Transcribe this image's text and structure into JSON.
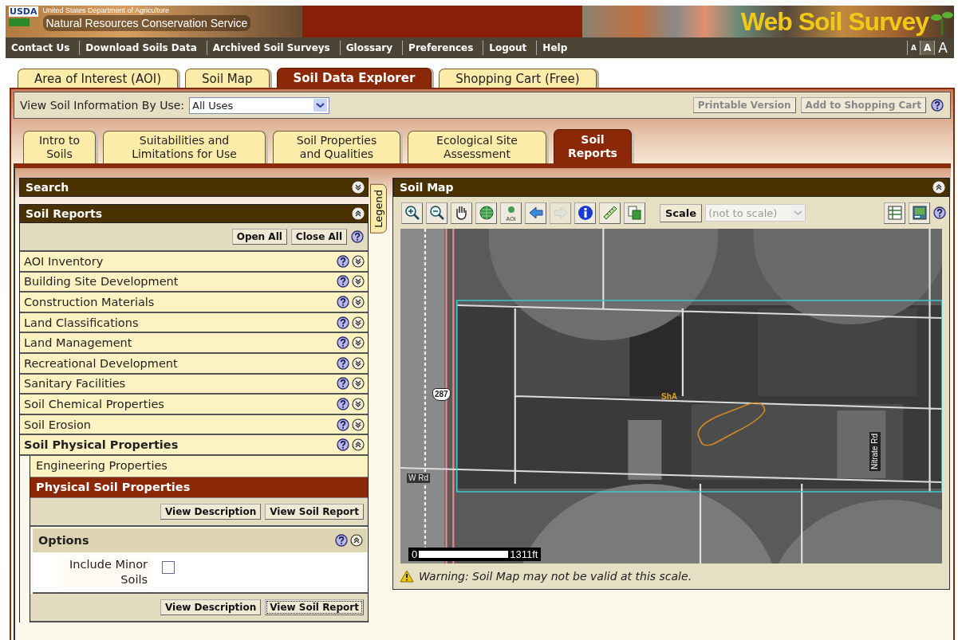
{
  "header": {
    "agency_small": "United States Department of Agriculture",
    "agency": "Natural Resources Conservation Service",
    "logo": "USDA",
    "app_title": "Web Soil Survey"
  },
  "nav": {
    "links": [
      "Contact Us",
      "Download Soils Data",
      "Archived Soil Surveys",
      "Glossary",
      "Preferences",
      "Logout",
      "Help"
    ],
    "text_sizes": [
      {
        "label": "A",
        "selected": false
      },
      {
        "label": "A",
        "selected": true
      },
      {
        "label": "A",
        "selected": false
      }
    ]
  },
  "main_tabs": [
    {
      "label": "Area of Interest (AOI)",
      "selected": false
    },
    {
      "label": "Soil Map",
      "selected": false
    },
    {
      "label": "Soil Data Explorer",
      "selected": true
    },
    {
      "label": "Shopping Cart (Free)",
      "selected": false
    }
  ],
  "toolbar": {
    "label": "View Soil Information By Use:",
    "select_value": "All Uses",
    "buttons": [
      {
        "label": "Printable Version",
        "disabled": true
      },
      {
        "label": "Add to Shopping Cart",
        "disabled": true
      }
    ]
  },
  "sub_tabs": [
    {
      "label": "Intro to Soils",
      "selected": false
    },
    {
      "label": "Suitabilities and Limitations for Use",
      "selected": false
    },
    {
      "label": "Soil Properties and Qualities",
      "selected": false
    },
    {
      "label": "Ecological Site Assessment",
      "selected": false
    },
    {
      "label": "Soil Reports",
      "selected": true
    }
  ],
  "search_panel": {
    "title": "Search",
    "expanded": false
  },
  "soil_reports": {
    "title": "Soil Reports",
    "expanded": true,
    "buttons": [
      "Open All",
      "Close All"
    ],
    "categories": [
      {
        "label": "AOI Inventory",
        "expanded": false
      },
      {
        "label": "Building Site Development",
        "expanded": false
      },
      {
        "label": "Construction Materials",
        "expanded": false
      },
      {
        "label": "Land Classifications",
        "expanded": false
      },
      {
        "label": "Land Management",
        "expanded": false
      },
      {
        "label": "Recreational Development",
        "expanded": false
      },
      {
        "label": "Sanitary Facilities",
        "expanded": false
      },
      {
        "label": "Soil Chemical Properties",
        "expanded": false
      },
      {
        "label": "Soil Erosion",
        "expanded": false
      },
      {
        "label": "Soil Physical Properties",
        "expanded": true,
        "children": [
          {
            "label": "Engineering Properties",
            "selected": false
          },
          {
            "label": "Physical Soil Properties",
            "selected": true,
            "buttons": [
              "View Description",
              "View Soil Report"
            ],
            "options": {
              "title": "Options",
              "expanded": true,
              "checkbox": {
                "label": "Include Minor Soils",
                "checked": false
              }
            },
            "bottom_buttons": [
              {
                "label": "View Description",
                "focused": false
              },
              {
                "label": "View Soil Report",
                "focused": true
              }
            ]
          }
        ]
      }
    ]
  },
  "legend_tab": "Legend",
  "map_panel": {
    "title": "Soil Map",
    "expanded": true,
    "tools": [
      {
        "kind": "zoom-in",
        "disabled": false
      },
      {
        "kind": "zoom-out",
        "disabled": false
      },
      {
        "kind": "pan",
        "disabled": false
      },
      {
        "kind": "globe",
        "disabled": false
      },
      {
        "kind": "aoi",
        "label": "AOI",
        "disabled": false
      },
      {
        "kind": "back",
        "disabled": false
      },
      {
        "kind": "forward",
        "disabled": true
      },
      {
        "kind": "info",
        "disabled": false
      },
      {
        "kind": "measure",
        "disabled": false
      },
      {
        "kind": "copy",
        "disabled": false
      }
    ],
    "scale_button": "Scale",
    "scale_select": {
      "value": "(not to scale)",
      "disabled": true
    },
    "map_labels": [
      {
        "kind": "shield",
        "text": "287"
      },
      {
        "kind": "soil",
        "text": "ShA"
      },
      {
        "kind": "road",
        "text": "W Rd"
      },
      {
        "kind": "road-vertical",
        "text": "Nitrate Rd"
      }
    ],
    "scale_bar": {
      "start": "0",
      "end": "1311ft"
    },
    "warning": "Warning: Soil Map may not be valid at this scale."
  }
}
